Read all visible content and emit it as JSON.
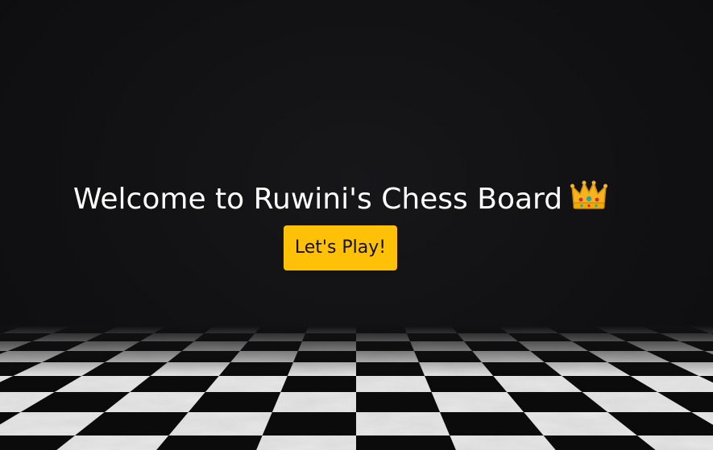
{
  "hero": {
    "title": "Welcome to Ruwini's Chess Board",
    "title_icon": "crown-icon",
    "play_label": "Let's Play!"
  },
  "theme": {
    "background": "#111113",
    "accent": "#ffc107",
    "title_color": "#ffffff",
    "floor_light": "#e8e8e8",
    "floor_dark": "#0b0b0b"
  }
}
